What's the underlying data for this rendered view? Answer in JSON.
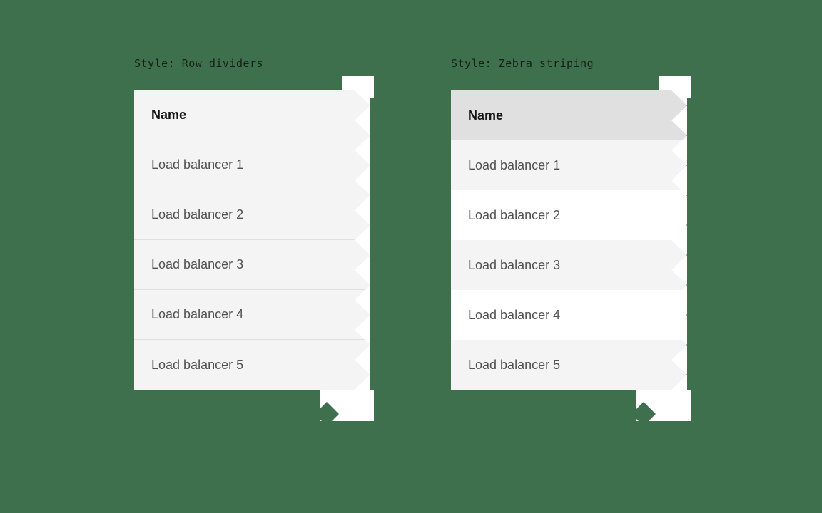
{
  "labels": {
    "dividers": "Style: Row dividers",
    "zebra": "Style: Zebra striping"
  },
  "columns": {
    "name": "Name"
  },
  "rows": [
    "Load balancer 1",
    "Load balancer 2",
    "Load balancer 3",
    "Load balancer 4",
    "Load balancer 5"
  ]
}
